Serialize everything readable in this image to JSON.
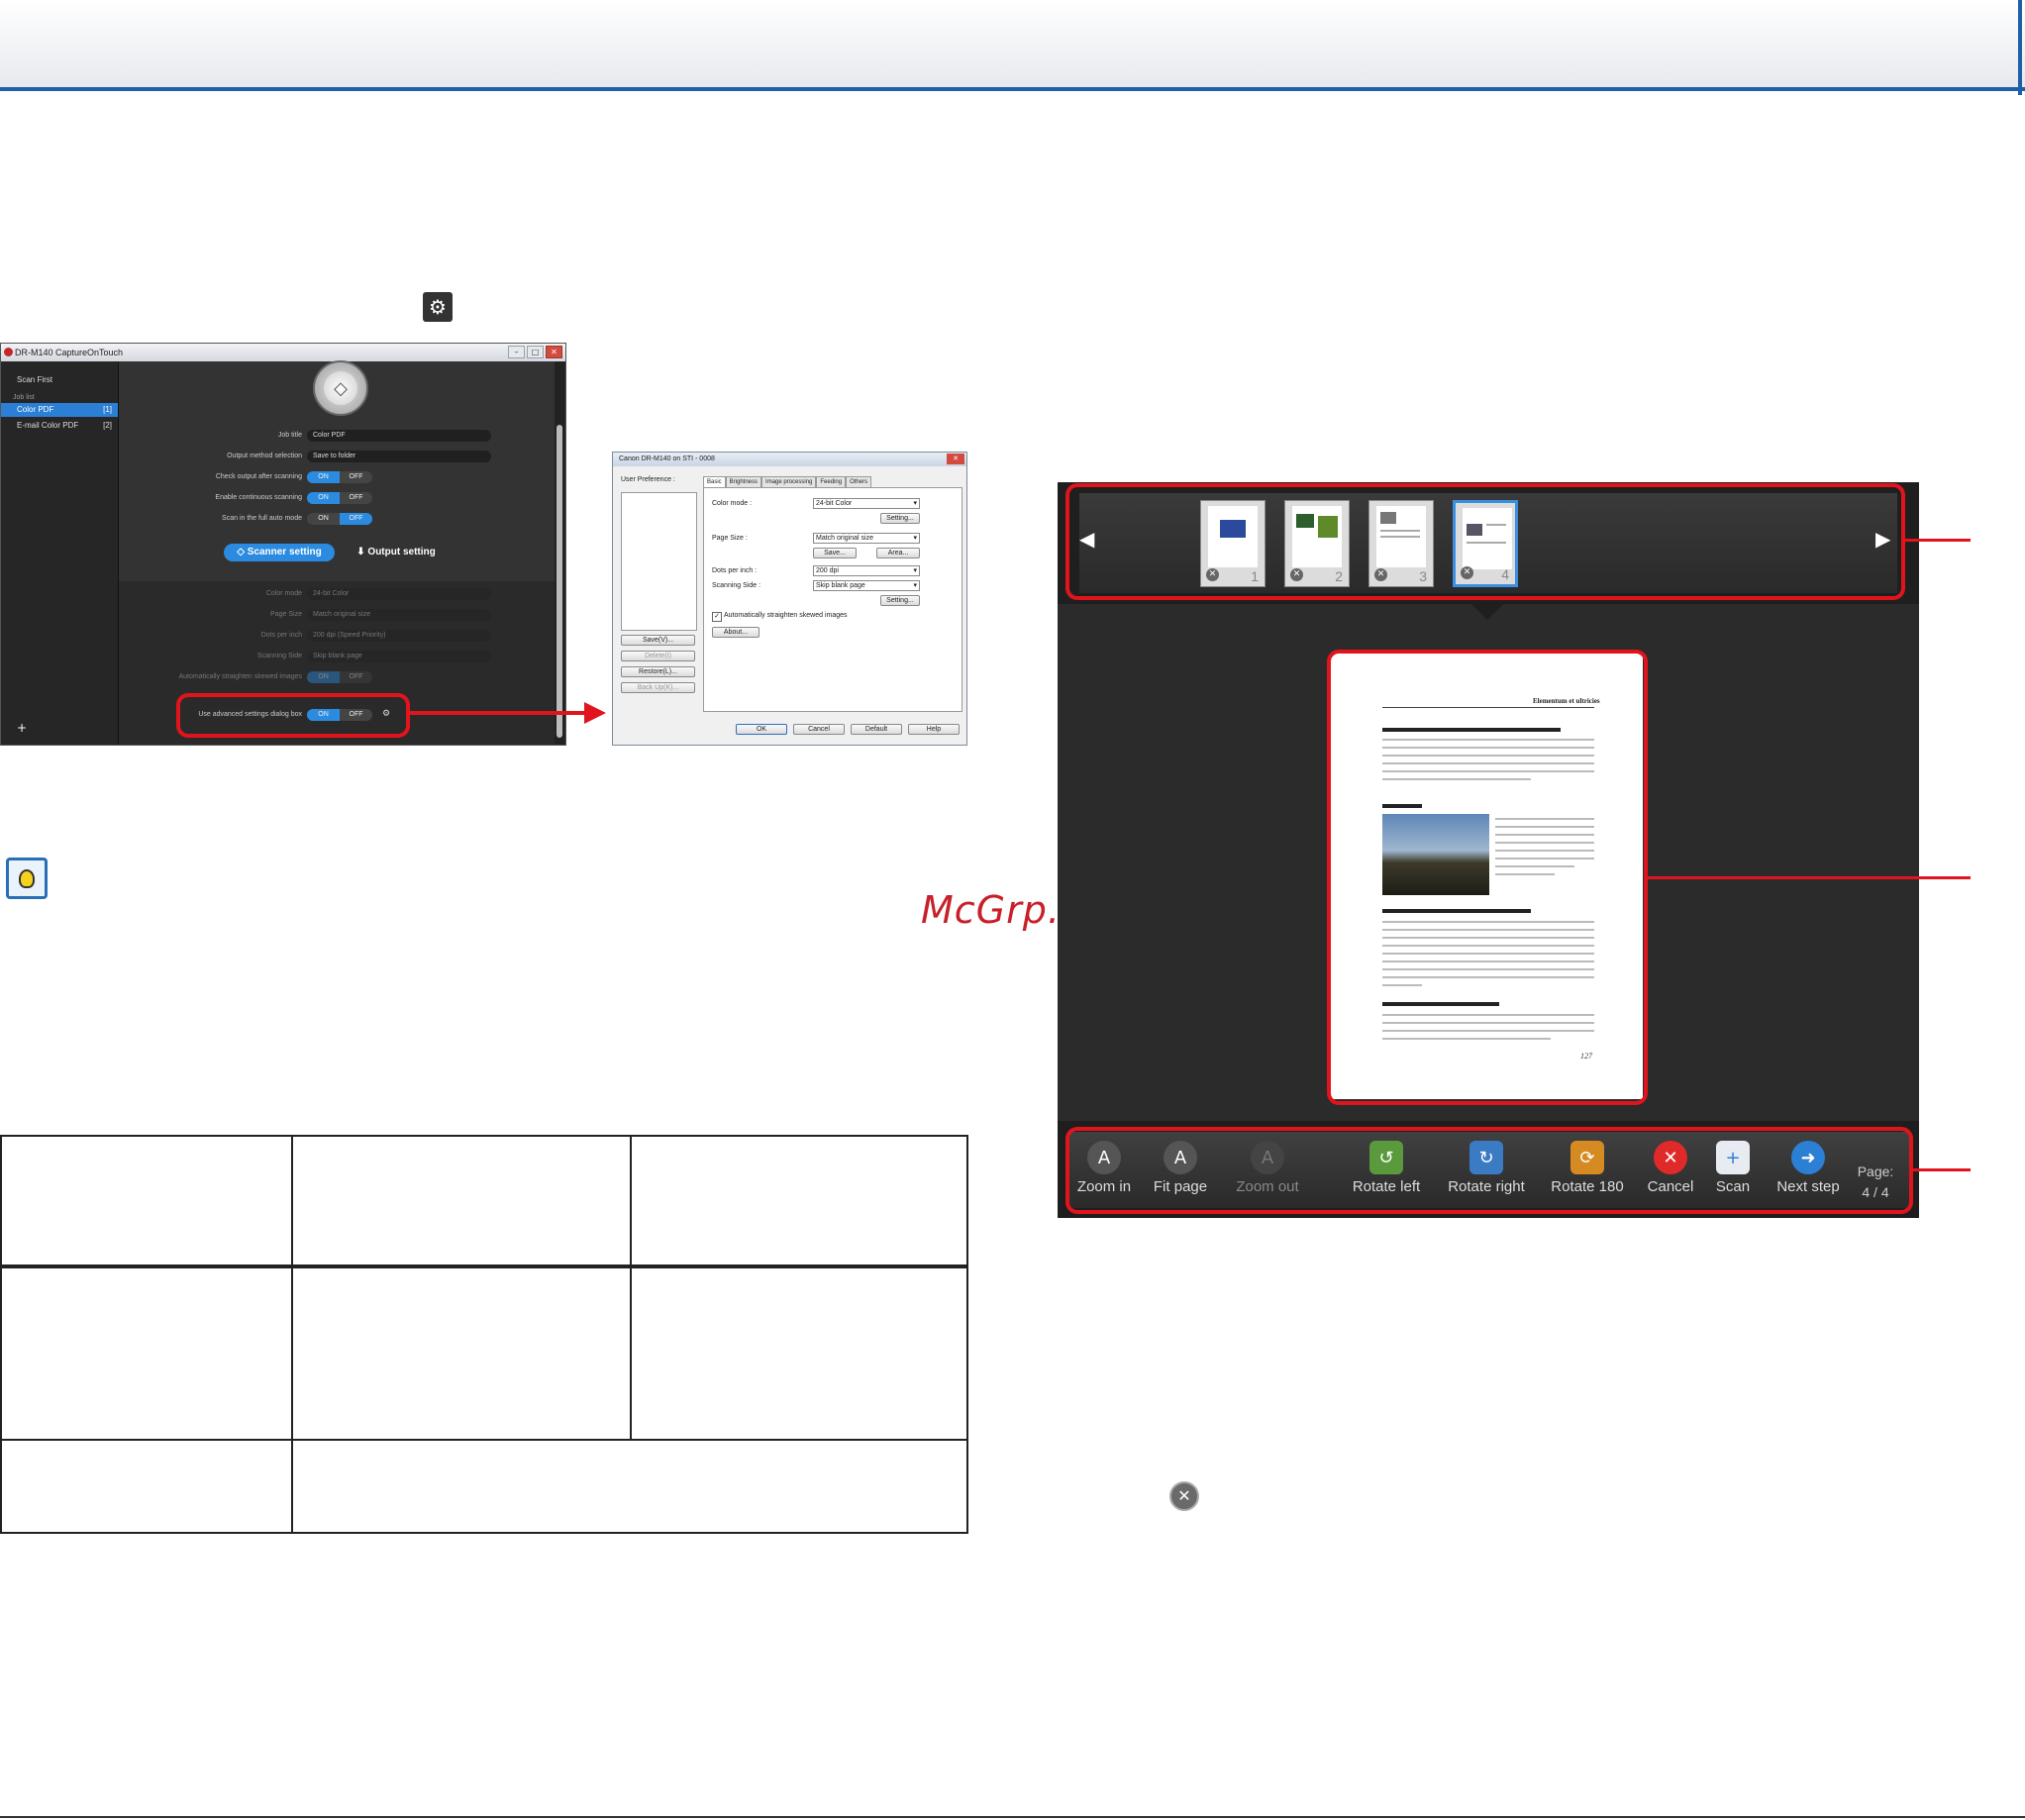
{
  "watermark": "McGrp.Ru",
  "capture_on_touch": {
    "title": "DR-M140 CaptureOnTouch",
    "sidebar": {
      "scan_first": "Scan First",
      "job_list_label": "Job list",
      "items": [
        {
          "label": "Color PDF",
          "num": "[1]",
          "selected": true
        },
        {
          "label": "E-mail Color PDF",
          "num": "[2]",
          "selected": false
        }
      ]
    },
    "job_title_label": "Job title",
    "job_title_value": "Color PDF",
    "output_method_label": "Output method selection",
    "output_method_value": "Save to folder",
    "check_output_label": "Check output after scanning",
    "continuous_label": "Enable continuous scanning",
    "full_auto_label": "Scan in the full auto mode",
    "on": "ON",
    "off": "OFF",
    "scanner_setting_tab": "Scanner setting",
    "output_setting_tab": "Output setting",
    "color_mode_label": "Color mode",
    "color_mode_value": "24-bit Color",
    "page_size_label": "Page Size",
    "page_size_value": "Match original size",
    "dpi_label": "Dots per inch",
    "dpi_value": "200 dpi (Speed Priority)",
    "scanning_side_label": "Scanning Side",
    "scanning_side_value": "Skip blank page",
    "deskew_label": "Automatically straighten skewed images",
    "advanced_label": "Use advanced settings dialog box"
  },
  "dialog": {
    "title": "Canon DR-M140 on STI - 0008",
    "user_preference": "User Preference :",
    "tabs": [
      "Basic",
      "Brightness",
      "Image processing",
      "Feeding",
      "Others"
    ],
    "color_mode_label": "Color mode :",
    "color_mode_value": "24-bit Color",
    "setting": "Setting...",
    "page_size_label": "Page Size :",
    "page_size_value": "Match original size",
    "save": "Save...",
    "area": "Area...",
    "dpi_label": "Dots per inch :",
    "dpi_value": "200 dpi",
    "scanning_side_label": "Scanning Side :",
    "scanning_side_value": "Skip blank page",
    "deskew": "Automatically straighten skewed images",
    "about": "About...",
    "left_buttons": [
      "Save(V)...",
      "Delete(I)",
      "Restore(L)...",
      "Back Up(K)..."
    ],
    "bottom_buttons": [
      "OK",
      "Cancel",
      "Default",
      "Help"
    ]
  },
  "review": {
    "thumbnails": [
      "1",
      "2",
      "3",
      "4"
    ],
    "document_title": "Elementum et ultricies",
    "page_number": "127",
    "tools": [
      {
        "label": "Zoom in",
        "icon": "zoom-in-icon",
        "glyph": "A"
      },
      {
        "label": "Fit page",
        "icon": "fit-page-icon",
        "glyph": "A"
      },
      {
        "label": "Zoom out",
        "icon": "zoom-out-icon",
        "glyph": "A"
      },
      {
        "label": "Rotate left",
        "icon": "rotate-left-icon",
        "glyph": "↺"
      },
      {
        "label": "Rotate right",
        "icon": "rotate-right-icon",
        "glyph": "↻"
      },
      {
        "label": "Rotate 180",
        "icon": "rotate-180-icon",
        "glyph": "⟳"
      },
      {
        "label": "Cancel",
        "icon": "cancel-icon",
        "glyph": "✕"
      },
      {
        "label": "Scan",
        "icon": "scan-icon",
        "glyph": "+"
      },
      {
        "label": "Next step",
        "icon": "next-step-icon",
        "glyph": "➜"
      }
    ],
    "page_label": "Page:",
    "page_value": "4 / 4"
  },
  "colors": {
    "accent_blue": "#1f5fa8",
    "highlight_red": "#e1141d",
    "toggle_blue": "#2b8be0"
  }
}
